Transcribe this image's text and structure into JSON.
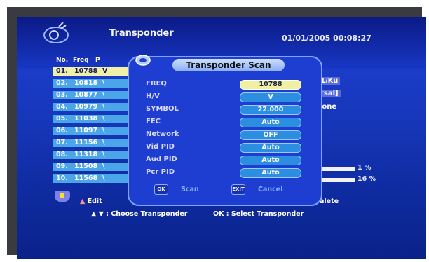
{
  "header": {
    "title": "Transponder",
    "datetime": "01/01/2005  00:08:27"
  },
  "list": {
    "columns": [
      "No.",
      "Freq",
      "P"
    ],
    "rows": [
      {
        "no": "01.",
        "freq": "10788",
        "suffix": "V",
        "selected": true
      },
      {
        "no": "02.",
        "freq": "10818",
        "suffix": "\\"
      },
      {
        "no": "03.",
        "freq": "10877",
        "suffix": "\\"
      },
      {
        "no": "04.",
        "freq": "10979",
        "suffix": "\\"
      },
      {
        "no": "05.",
        "freq": "11038",
        "suffix": "\\"
      },
      {
        "no": "06.",
        "freq": "11097",
        "suffix": "\\"
      },
      {
        "no": "07.",
        "freq": "11156",
        "suffix": "\\"
      },
      {
        "no": "08.",
        "freq": "11318",
        "suffix": "\\"
      },
      {
        "no": "09.",
        "freq": "11508",
        "suffix": "\\"
      },
      {
        "no": "10.",
        "freq": "11568",
        "suffix": "\\"
      }
    ]
  },
  "right_info": {
    "band": "1/Ku",
    "type": "rsal]",
    "status": "lone"
  },
  "signal": {
    "bar1_pct": "1 %",
    "bar2_pct": "16 %"
  },
  "footer": {
    "edit": "Edit",
    "delete": "alete",
    "hint_choose": "▲ ▼ : Choose Transponder",
    "hint_ok": "OK : Select Transponder"
  },
  "dialog": {
    "title": "Transponder Scan",
    "fields": [
      {
        "label": "FREQ",
        "value": "10788",
        "selected": true
      },
      {
        "label": "H/V",
        "value": "V"
      },
      {
        "label": "SYMBOL",
        "value": "22.000"
      },
      {
        "label": "FEC",
        "value": "Auto"
      },
      {
        "label": "Network",
        "value": "OFF"
      },
      {
        "label": "Vid PID",
        "value": "Auto"
      },
      {
        "label": "Aud PID",
        "value": "Auto"
      },
      {
        "label": "Pcr PID",
        "value": "Auto"
      }
    ],
    "ok_key": "OK",
    "scan_label": "Scan",
    "exit_key": "EXIT",
    "cancel_label": "Cancel"
  }
}
